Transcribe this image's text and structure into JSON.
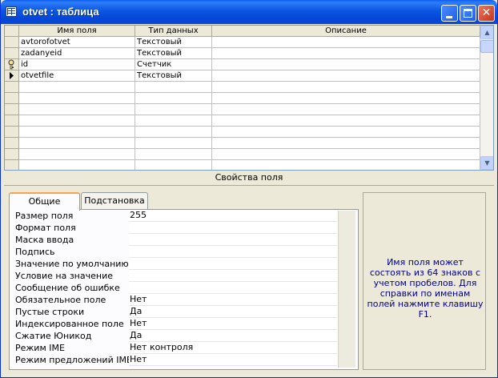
{
  "window": {
    "title": "otvet : таблица"
  },
  "grid": {
    "headers": {
      "name": "Имя поля",
      "type": "Тип данных",
      "desc": "Описание"
    },
    "rows": [
      {
        "name": "avtorofotvet",
        "type": "Текстовый",
        "desc": "",
        "marker": ""
      },
      {
        "name": "zadanyeid",
        "type": "Текстовый",
        "desc": "",
        "marker": ""
      },
      {
        "name": "id",
        "type": "Счетчик",
        "desc": "",
        "marker": "key"
      },
      {
        "name": "otvetfile",
        "type": "Текстовый",
        "desc": "",
        "marker": "current"
      }
    ]
  },
  "section_title": "Свойства поля",
  "tabs": [
    {
      "label": "Общие",
      "active": true
    },
    {
      "label": "Подстановка",
      "active": false
    }
  ],
  "properties": [
    {
      "label": "Размер поля",
      "value": "255"
    },
    {
      "label": "Формат поля",
      "value": ""
    },
    {
      "label": "Маска ввода",
      "value": ""
    },
    {
      "label": "Подпись",
      "value": ""
    },
    {
      "label": "Значение по умолчанию",
      "value": ""
    },
    {
      "label": "Условие на значение",
      "value": ""
    },
    {
      "label": "Сообщение об ошибке",
      "value": ""
    },
    {
      "label": "Обязательное поле",
      "value": "Нет"
    },
    {
      "label": "Пустые строки",
      "value": "Да"
    },
    {
      "label": "Индексированное поле",
      "value": "Нет"
    },
    {
      "label": "Сжатие Юникод",
      "value": "Да"
    },
    {
      "label": "Режим IME",
      "value": "Нет контроля"
    },
    {
      "label": "Режим предложений IME",
      "value": "Нет"
    }
  ],
  "hint": "Имя поля может состоять из 64 знаков с учетом пробелов.  Для справки по именам полей нажмите клавишу F1.",
  "colors": {
    "hint_text": "#00008B",
    "titlebar": "#0B56E1"
  }
}
